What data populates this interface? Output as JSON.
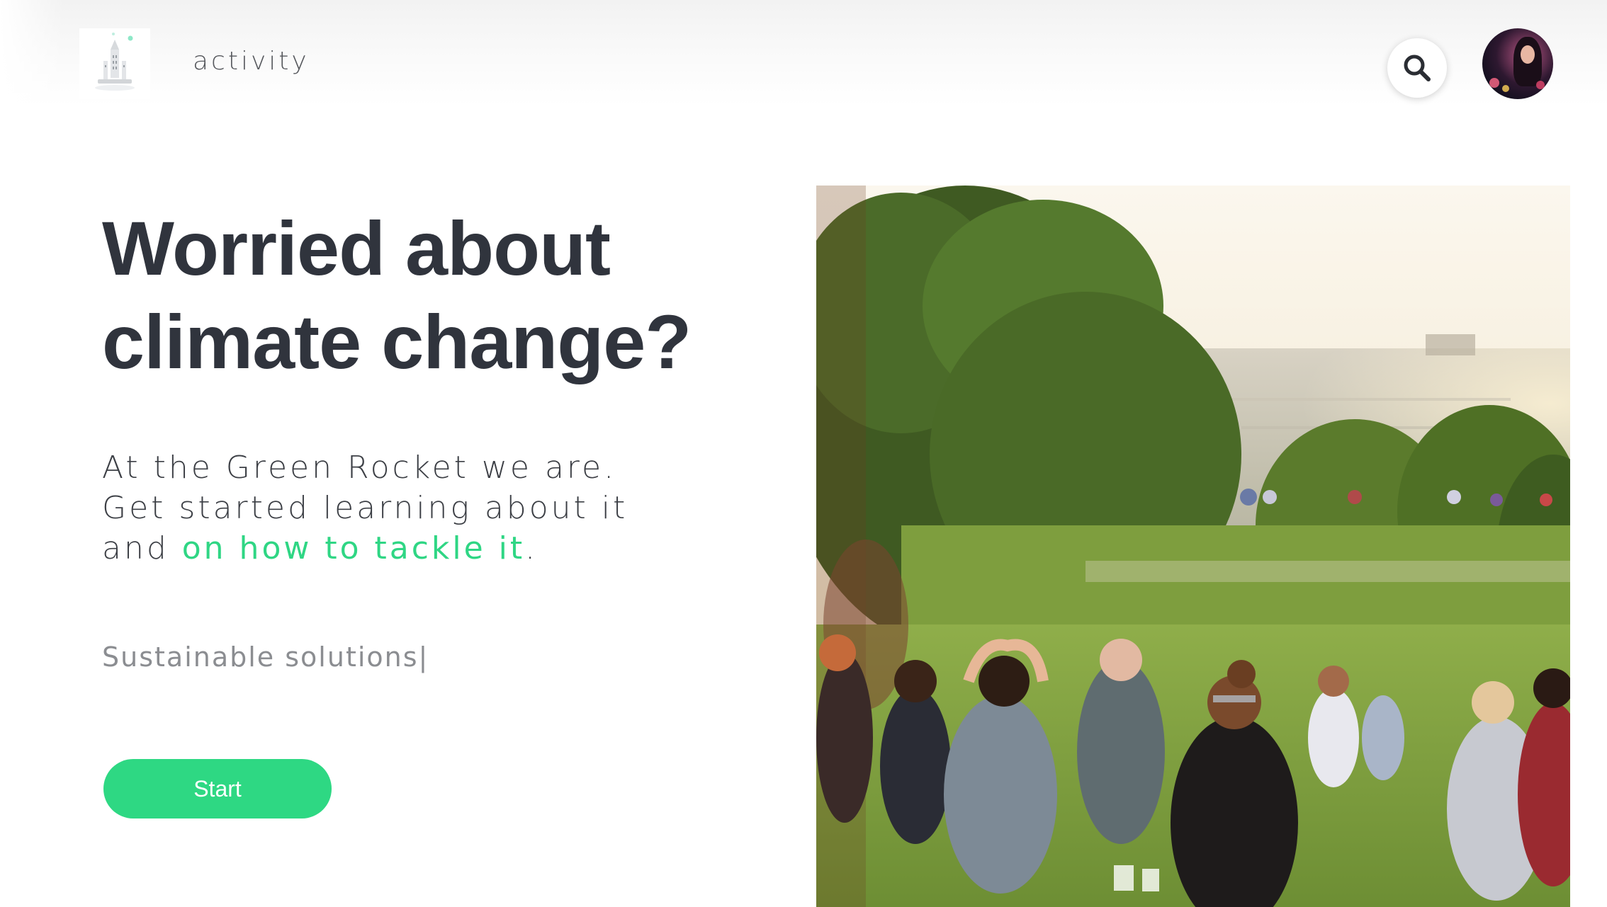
{
  "header": {
    "logo_name": "green-rocket-logo",
    "nav_link": "activity",
    "search_icon": "search-icon",
    "avatar": "user-avatar"
  },
  "hero": {
    "headline_line1": "Worried about",
    "headline_line2": "climate change?",
    "lead_line1": "At the Green Rocket we are.",
    "lead_line2": "Get started learning about it",
    "lead_line3_prefix": "and ",
    "lead_line3_accent": "on how to tackle it",
    "lead_line3_suffix": ".",
    "typing_text": "Sustainable solutions|",
    "start_button": "Start",
    "image_subject": "people sitting on a grassy hill in a park at sunset"
  },
  "colors": {
    "accent": "#2fd684",
    "button": "#2ed883",
    "headline": "#30343d",
    "body_text": "#3c3f45",
    "muted_text": "#8b8d91"
  }
}
